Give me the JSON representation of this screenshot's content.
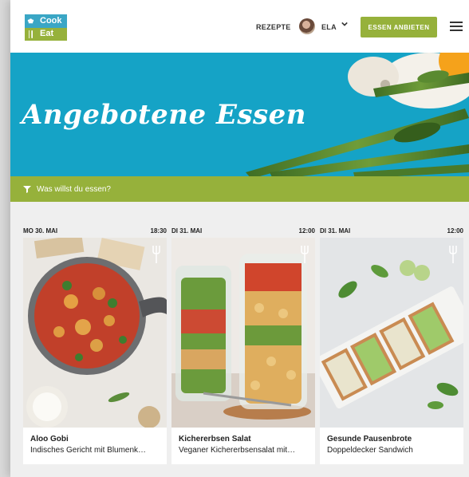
{
  "header": {
    "logo": {
      "top": "Cook",
      "bottom": "Eat"
    },
    "nav_rezepte": "REZEPTE",
    "user_name": "ELA",
    "cta_label": "ESSEN ANBIETEN"
  },
  "hero": {
    "title": "Angebotene Essen"
  },
  "filter": {
    "label": "Was willst du essen?"
  },
  "cards": [
    {
      "date": "MO 30. MAI",
      "time": "18:30",
      "title": "Aloo Gobi",
      "subtitle": "Indisches Gericht mit Blumenk…"
    },
    {
      "date": "DI 31. MAI",
      "time": "12:00",
      "title": "Kichererbsen Salat",
      "subtitle": "Veganer Kichererbsensalat mit…"
    },
    {
      "date": "DI 31. MAI",
      "time": "12:00",
      "title": "Gesunde Pausenbrote",
      "subtitle": "Doppeldecker Sandwich"
    }
  ],
  "colors": {
    "blue": "#15a3c6",
    "green": "#96b13b"
  }
}
